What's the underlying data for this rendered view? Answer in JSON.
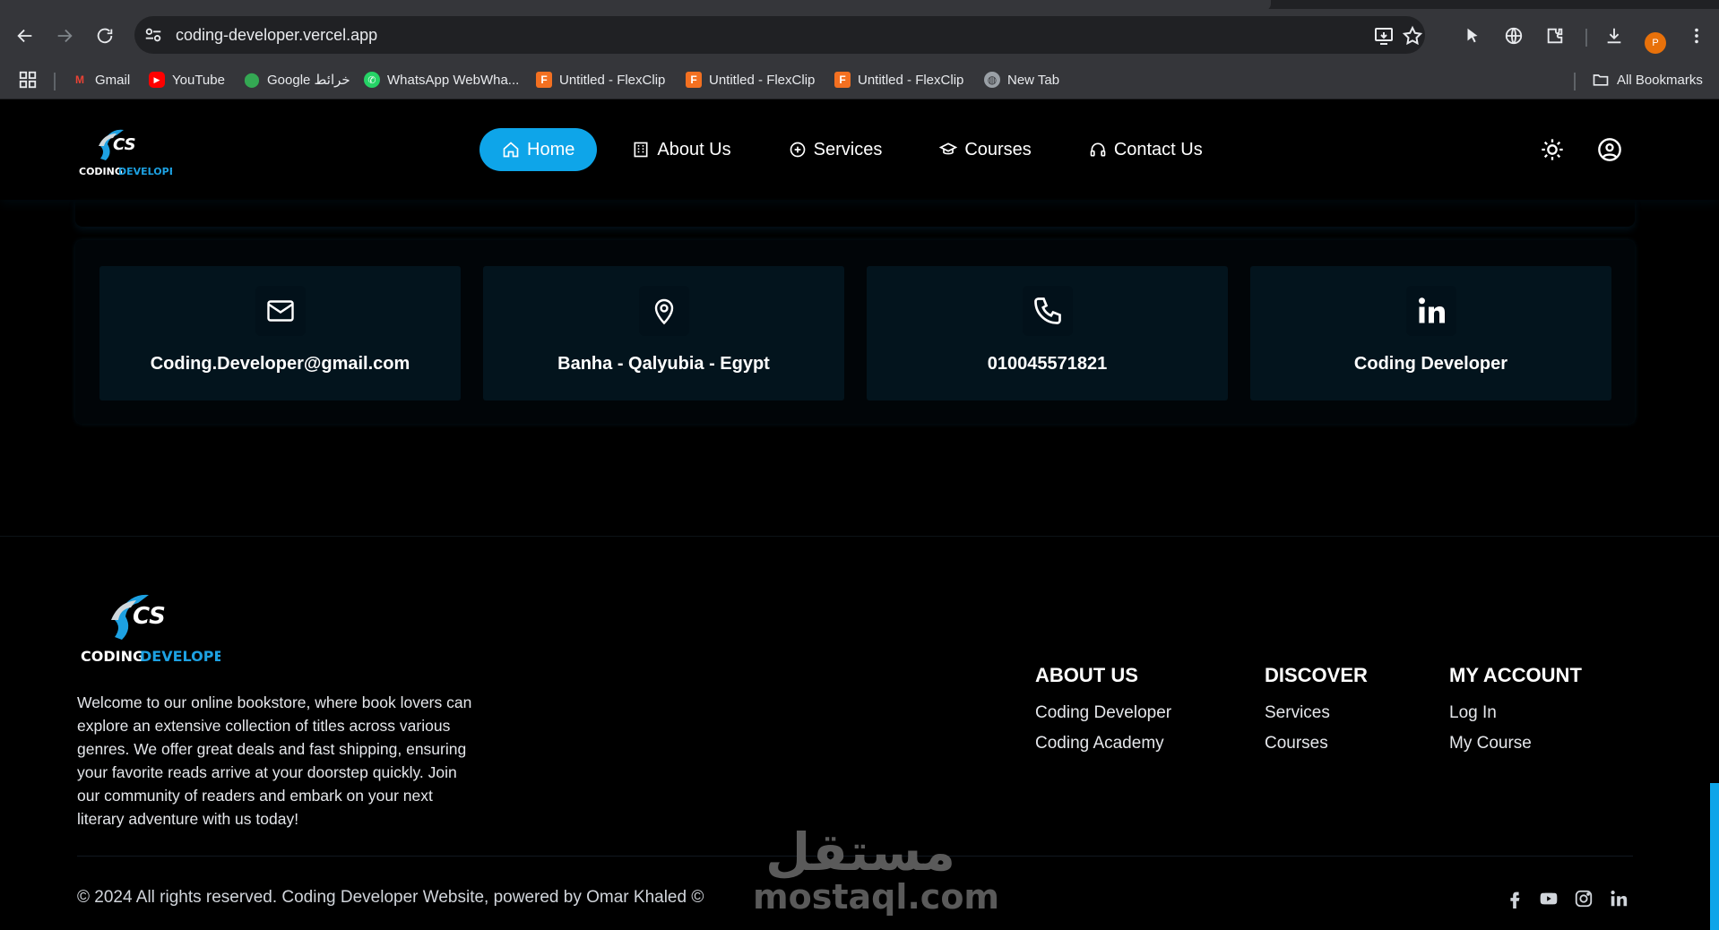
{
  "browser": {
    "url": "coding-developer.vercel.app",
    "profile_initial": "P",
    "bookmarks": [
      {
        "label": "Gmail",
        "icon": "gmail-icon"
      },
      {
        "label": "YouTube",
        "icon": "youtube-icon"
      },
      {
        "label": "Google خرائط",
        "icon": "maps-icon"
      },
      {
        "label": "WhatsApp WebWha...",
        "icon": "whatsapp-icon"
      },
      {
        "label": "Untitled - FlexClip",
        "icon": "flexclip-icon"
      },
      {
        "label": "Untitled - FlexClip",
        "icon": "flexclip-icon"
      },
      {
        "label": "Untitled - FlexClip",
        "icon": "flexclip-icon"
      },
      {
        "label": "New Tab",
        "icon": "globe-icon"
      }
    ],
    "all_bookmarks": "All Bookmarks"
  },
  "nav": {
    "items": [
      {
        "label": "Home",
        "icon": "home-icon",
        "active": true
      },
      {
        "label": "About Us",
        "icon": "building-icon"
      },
      {
        "label": "Services",
        "icon": "plus-circle-icon"
      },
      {
        "label": "Courses",
        "icon": "graduation-cap-icon"
      },
      {
        "label": "Contact Us",
        "icon": "headset-icon"
      }
    ]
  },
  "contact": {
    "cards": [
      {
        "label": "Coding.Developer@gmail.com",
        "icon": "mail-icon"
      },
      {
        "label": "Banha - Qalyubia - Egypt",
        "icon": "location-pin-icon"
      },
      {
        "label": "010045571821",
        "icon": "phone-icon"
      },
      {
        "label": "Coding Developer",
        "icon": "linkedin-icon"
      }
    ]
  },
  "logo": {
    "top": "CS",
    "bottom_white": "CODING",
    "bottom_blue": "DEVELOPER"
  },
  "footer": {
    "about_text": "Welcome to our online bookstore, where book lovers can explore an extensive collection of titles across various genres. We offer great deals and fast shipping, ensuring your favorite reads arrive at your doorstep quickly. Join our community of readers and embark on your next literary adventure with us today!",
    "columns": [
      {
        "title": "ABOUT US",
        "links": [
          "Coding Developer",
          "Coding Academy"
        ]
      },
      {
        "title": "DISCOVER",
        "links": [
          "Services",
          "Courses"
        ]
      },
      {
        "title": "MY ACCOUNT",
        "links": [
          "Log In",
          "My Course"
        ]
      }
    ],
    "copyright": "© 2024 All rights reserved. Coding Developer Website, powered by Omar Khaled ©",
    "social": [
      "facebook-icon",
      "youtube-icon",
      "instagram-icon",
      "linkedin-icon"
    ]
  },
  "watermark": {
    "arabic": "مستقل",
    "latin": "mostaql.com"
  },
  "colors": {
    "accent": "#0ea5e9",
    "card_bg": "#03141d",
    "chrome": "#35363a"
  }
}
